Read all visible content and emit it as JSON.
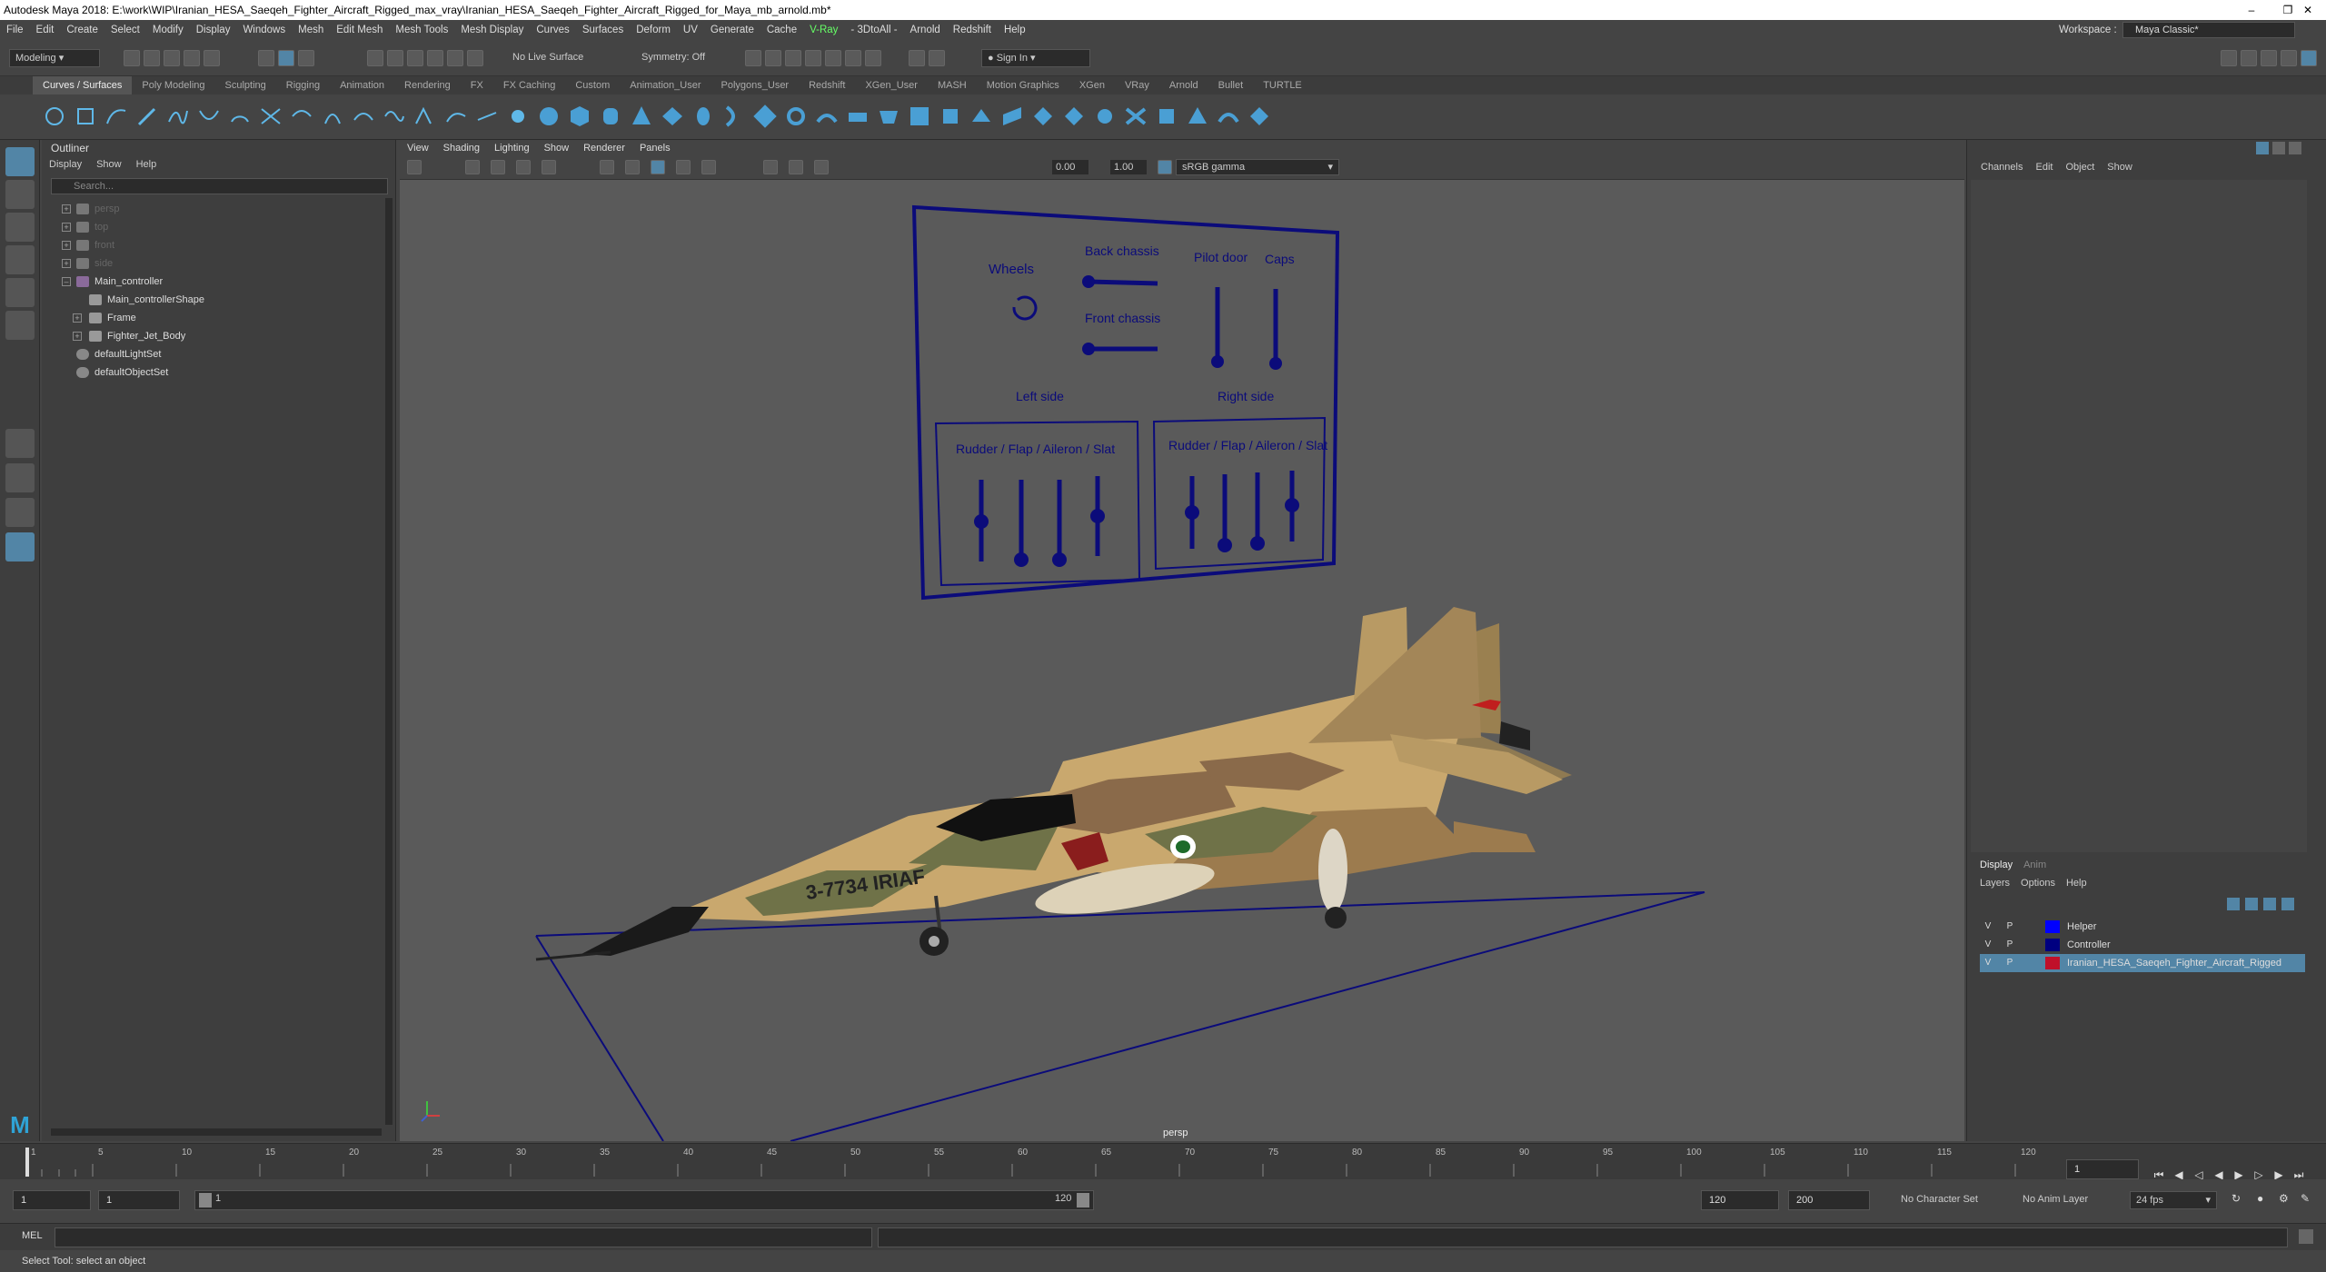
{
  "app": {
    "title": "Autodesk Maya 2018: E:\\work\\WIP\\Iranian_HESA_Saeqeh_Fighter_Aircraft_Rigged_max_vray\\Iranian_HESA_Saeqeh_Fighter_Aircraft_Rigged_for_Maya_mb_arnold.mb*"
  },
  "menubar": {
    "items": [
      "File",
      "Edit",
      "Create",
      "Select",
      "Modify",
      "Display",
      "Windows",
      "Mesh",
      "Edit Mesh",
      "Mesh Tools",
      "Mesh Display",
      "Curves",
      "Surfaces",
      "Deform",
      "UV",
      "Generate",
      "Cache",
      "V-Ray",
      "- 3DtoAll -",
      "Arnold",
      "Redshift",
      "Help"
    ],
    "workspace_label": "Workspace :",
    "workspace_value": "Maya Classic*"
  },
  "statusline": {
    "mode": "Modeling",
    "live_surface": "No Live Surface",
    "symmetry": "Symmetry: Off",
    "sign_in": "Sign In"
  },
  "shelf": {
    "tabs": [
      "Curves / Surfaces",
      "Poly Modeling",
      "Sculpting",
      "Rigging",
      "Animation",
      "Rendering",
      "FX",
      "FX Caching",
      "Custom",
      "Animation_User",
      "Polygons_User",
      "Redshift",
      "XGen_User",
      "MASH",
      "Motion Graphics",
      "XGen",
      "VRay",
      "Arnold",
      "Bullet",
      "TURTLE"
    ],
    "active_tab": "Curves / Surfaces"
  },
  "outliner": {
    "title": "Outliner",
    "menu": [
      "Display",
      "Show",
      "Help"
    ],
    "search_placeholder": "Search...",
    "items": [
      "persp",
      "top",
      "front",
      "side",
      "Main_controller",
      "Main_controllerShape",
      "Frame",
      "Fighter_Jet_Body",
      "defaultLightSet",
      "defaultObjectSet"
    ]
  },
  "viewport": {
    "menu": [
      "View",
      "Shading",
      "Lighting",
      "Show",
      "Renderer",
      "Panels"
    ],
    "exposure": "0.00",
    "gamma": "1.00",
    "color_space": "sRGB gamma",
    "camera_label": "persp",
    "controls_panel": {
      "wheels": "Wheels",
      "back_chassis": "Back chassis",
      "front_chassis": "Front chassis",
      "pilot_door": "Pilot door",
      "caps": "Caps",
      "left_side": "Left side",
      "right_side": "Right side",
      "rudder_left": "Rudder / Flap / Aileron / Slat",
      "rudder_right": "Rudder / Flap / Aileron / Slat"
    },
    "aircraft_marking": "3-7734 IRIAF"
  },
  "channel_box": {
    "menu": [
      "Channels",
      "Edit",
      "Object",
      "Show"
    ]
  },
  "layer_editor": {
    "tabs": [
      "Display",
      "Anim"
    ],
    "menu": [
      "Layers",
      "Options",
      "Help"
    ],
    "layers": [
      {
        "v": "V",
        "p": "P",
        "name": "Helper",
        "color": "#0000ff"
      },
      {
        "v": "V",
        "p": "P",
        "name": "Controller",
        "color": "#000080"
      },
      {
        "v": "V",
        "p": "P",
        "name": "Iranian_HESA_Saeqeh_Fighter_Aircraft_Rigged",
        "color": "#c0102a"
      }
    ]
  },
  "timeline": {
    "ticks": [
      "1",
      "5",
      "10",
      "15",
      "20",
      "25",
      "30",
      "35",
      "40",
      "45",
      "50",
      "55",
      "60",
      "65",
      "70",
      "75",
      "80",
      "85",
      "90",
      "95",
      "100",
      "105",
      "110",
      "115",
      "120"
    ],
    "current_frame": "1"
  },
  "range": {
    "start": "1",
    "playback_start": "1",
    "slider_start": "1",
    "slider_end": "120",
    "playback_end": "120",
    "end": "200",
    "character_set": "No Character Set",
    "anim_layer": "No Anim Layer",
    "fps": "24 fps"
  },
  "command": {
    "label": "MEL"
  },
  "help_line": "Select Tool: select an object",
  "colors": {
    "ui_bg": "#444444",
    "viewport_bg": "#5a5a5a",
    "controller_blue": "#0b0b7a",
    "camo_sand": "#c9a86e",
    "camo_brown": "#8a6a4a",
    "camo_green": "#6f7248"
  }
}
